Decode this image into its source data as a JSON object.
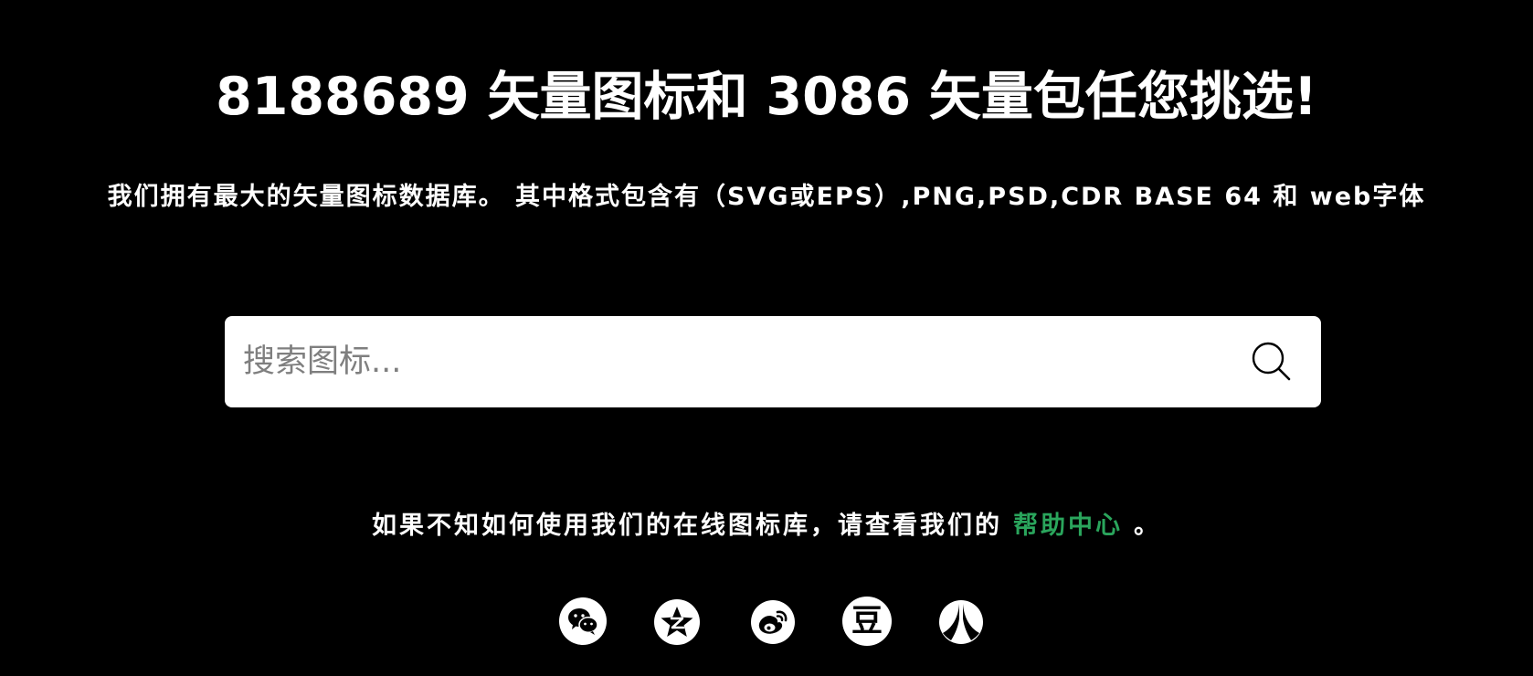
{
  "hero": {
    "headline": "8188689 矢量图标和 3086 矢量包任您挑选!",
    "subline": "我们拥有最大的矢量图标数据库。 其中格式包含有（SVG或EPS）,PNG,PSD,CDR BASE 64 和 web字体"
  },
  "search": {
    "placeholder": "搜索图标...",
    "value": "",
    "button_icon": "search-icon"
  },
  "help": {
    "prefix": "如果不知如何使用我们的在线图标库，请查看我们的",
    "link_label": "帮助中心",
    "suffix": "。",
    "link_color": "#2aa55c"
  },
  "socials": [
    {
      "icon": "wechat-icon"
    },
    {
      "icon": "qzone-icon"
    },
    {
      "icon": "weibo-icon"
    },
    {
      "icon": "douban-icon",
      "glyph": "豆"
    },
    {
      "icon": "renren-icon"
    }
  ],
  "colors": {
    "background": "#000000",
    "text": "#ffffff",
    "accent": "#2aa55c"
  }
}
